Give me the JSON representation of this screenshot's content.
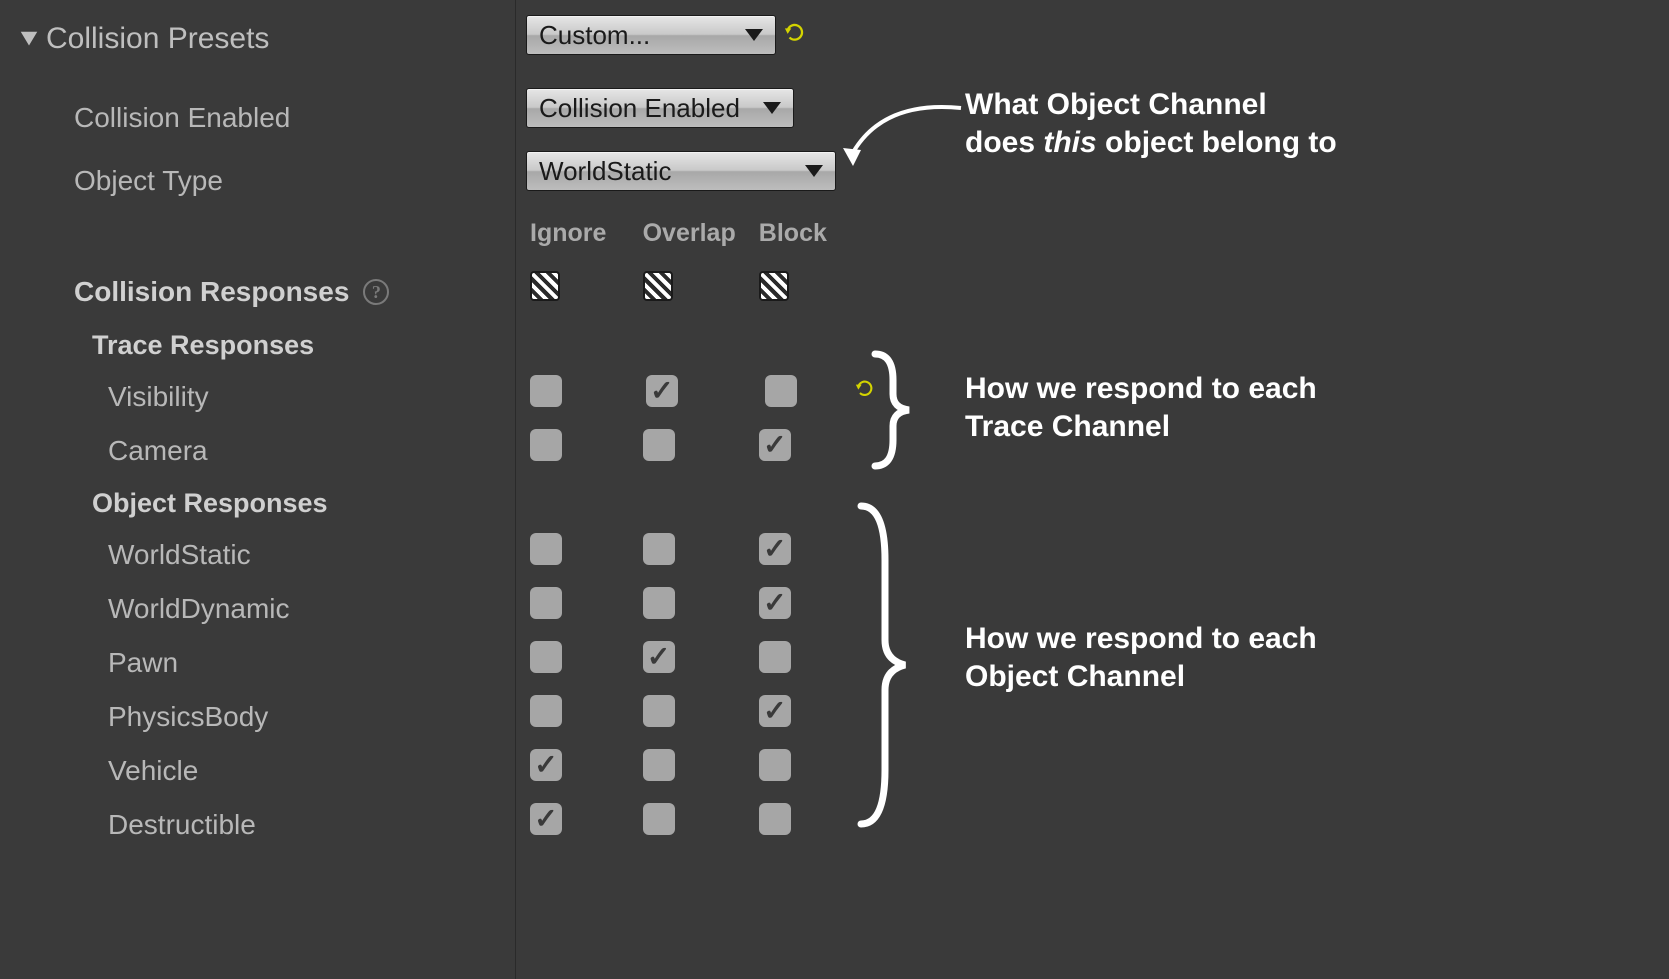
{
  "heading": "Collision Presets",
  "presets": {
    "dropdown_label": "Custom..."
  },
  "fields": {
    "collision_enabled_label": "Collision Enabled",
    "collision_enabled_value": "Collision Enabled",
    "object_type_label": "Object Type",
    "object_type_value": "WorldStatic"
  },
  "columns": {
    "ignore": "Ignore",
    "overlap": "Overlap",
    "block": "Block"
  },
  "responses_heading": "Collision Responses",
  "trace_heading": "Trace Responses",
  "object_heading": "Object Responses",
  "trace_channels": [
    {
      "name": "Visibility",
      "ignore": false,
      "overlap": true,
      "block": false,
      "reset": true
    },
    {
      "name": "Camera",
      "ignore": false,
      "overlap": false,
      "block": true,
      "reset": false
    }
  ],
  "object_channels": [
    {
      "name": "WorldStatic",
      "ignore": false,
      "overlap": false,
      "block": true
    },
    {
      "name": "WorldDynamic",
      "ignore": false,
      "overlap": false,
      "block": true
    },
    {
      "name": "Pawn",
      "ignore": false,
      "overlap": true,
      "block": false
    },
    {
      "name": "PhysicsBody",
      "ignore": false,
      "overlap": false,
      "block": true
    },
    {
      "name": "Vehicle",
      "ignore": true,
      "overlap": false,
      "block": false
    },
    {
      "name": "Destructible",
      "ignore": true,
      "overlap": false,
      "block": false
    }
  ],
  "annotations": {
    "object_channel": "What Object Channel does this object belong to",
    "object_channel_em": "this",
    "trace_response": "How we respond to each Trace Channel",
    "object_response": "How we respond to each Object Channel"
  }
}
